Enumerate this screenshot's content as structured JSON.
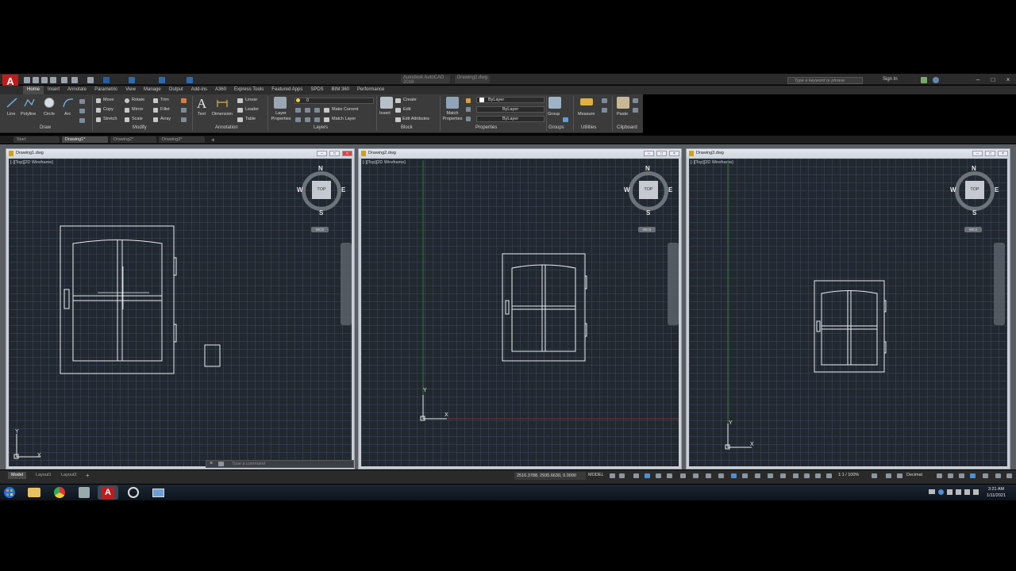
{
  "app": {
    "logo_letter": "A",
    "doc_title": [
      "Autodesk AutoCAD 2018",
      "Drawing2.dwg"
    ],
    "search_placeholder": "Type a keyword or phrase",
    "signin": "Sign In"
  },
  "ribbon_tabs": [
    "Home",
    "Insert",
    "Annotate",
    "Parametric",
    "View",
    "Manage",
    "Output",
    "Add-ins",
    "A360",
    "Express Tools",
    "Featured Apps",
    "SPDS",
    "BIM 360",
    "Performance"
  ],
  "ribbon": {
    "draw": {
      "title": "Draw",
      "line": "Line",
      "polyline": "Polyline",
      "circle": "Circle",
      "arc": "Arc"
    },
    "modify": {
      "title": "Modify",
      "move": "Move",
      "rotate": "Rotate",
      "trim": "Trim",
      "copy": "Copy",
      "mirror": "Mirror",
      "fillet": "Fillet",
      "stretch": "Stretch",
      "scale": "Scale",
      "array": "Array"
    },
    "annotation": {
      "title": "Annotation",
      "text": "Text",
      "dimension": "Dimension",
      "linear": "Linear",
      "leader": "Leader",
      "table": "Table"
    },
    "layers": {
      "title": "Layers",
      "layer_properties": "Layer Properties",
      "layer_value": "0",
      "make_current": "Make Current",
      "match_layer": "Match Layer"
    },
    "block": {
      "title": "Block",
      "insert": "Insert",
      "create": "Create",
      "edit": "Edit",
      "edit_attributes": "Edit Attributes"
    },
    "properties": {
      "title": "Properties",
      "match_properties": "Match Properties",
      "color": "ByLayer",
      "linetype": "ByLayer",
      "lineweight": "ByLayer"
    },
    "groups": {
      "title": "Groups",
      "group": "Group"
    },
    "utilities": {
      "title": "Utilities",
      "measure": "Measure"
    },
    "clipboard": {
      "title": "Clipboard",
      "paste": "Paste"
    }
  },
  "file_tabs": [
    "Start",
    "Drawing1*",
    "Drawing2*",
    "Drawing3*"
  ],
  "viewports": [
    {
      "title": "Drawing1.dwg",
      "label": "[-][Top][2D Wireframe]"
    },
    {
      "title": "Drawing2.dwg",
      "label": "[-][Top][2D Wireframe]"
    },
    {
      "title": "Drawing3.dwg",
      "label": "[-][Top][2D Wireframe]"
    }
  ],
  "viewcube": {
    "face": "TOP",
    "n": "N",
    "s": "S",
    "e": "E",
    "w": "W",
    "wcs": "WCS"
  },
  "axis": {
    "x": "X",
    "y": "Y"
  },
  "command_placeholder": "Type a command",
  "layout_tabs": [
    "Model",
    "Layout1",
    "Layout2"
  ],
  "status": {
    "coords": "2516.3788, 2935.6630, 0.0000",
    "model": "MODEL",
    "scale": "1:1 / 100%",
    "units": "Decimal"
  },
  "taskbar": {
    "time": "3:21 AM",
    "date": "1/11/2021"
  }
}
